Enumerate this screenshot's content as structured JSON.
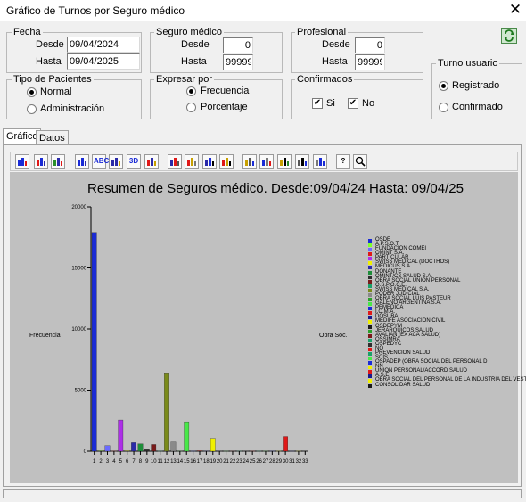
{
  "window": {
    "title": "Gráfico de Turnos por Seguro médico",
    "close_glyph": "✕"
  },
  "fecha": {
    "group_label": "Fecha",
    "desde_label": "Desde",
    "desde_value": "09/04/2024",
    "hasta_label": "Hasta",
    "hasta_value": "09/04/2025"
  },
  "seguro": {
    "group_label": "Seguro médico",
    "desde_label": "Desde",
    "desde_value": "0",
    "hasta_label": "Hasta",
    "hasta_value": "99999"
  },
  "profesional": {
    "group_label": "Profesional",
    "desde_label": "Desde",
    "desde_value": "0",
    "hasta_label": "Hasta",
    "hasta_value": "99999"
  },
  "turno_usuario": {
    "group_label": "Turno usuario",
    "options": [
      {
        "label": "Registrado",
        "selected": true
      },
      {
        "label": "Confirmado",
        "selected": false
      }
    ]
  },
  "tipo_pacientes": {
    "group_label": "Tipo de Pacientes",
    "options": [
      {
        "label": "Normal",
        "selected": true
      },
      {
        "label": "Administración",
        "selected": false
      }
    ]
  },
  "expresar_por": {
    "group_label": "Expresar por",
    "options": [
      {
        "label": "Frecuencia",
        "selected": true
      },
      {
        "label": "Porcentaje",
        "selected": false
      }
    ]
  },
  "confirmados": {
    "group_label": "Confirmados",
    "si_label": "Si",
    "si_checked": true,
    "no_label": "No",
    "no_checked": true
  },
  "tabs": [
    {
      "label": "Gráfico",
      "active": true
    },
    {
      "label": "Datos",
      "active": false
    }
  ],
  "toolbar": {
    "icons": [
      "bar-chart-icon",
      "pie-chart-icon",
      "stacked-bar-icon",
      "data-grid-icon",
      "abc-labels-icon",
      "table-icon",
      "3d-toggle-icon",
      "font-icon",
      "marker-icon",
      "scatter-icon",
      "color-icon",
      "crosshair-icon",
      "highlight-icon",
      "legend-icon",
      "tooltip-icon",
      "copy-icon",
      "edit-pen-icon",
      "help-icon",
      "zoom-icon"
    ],
    "text_glyphs": {
      "abc": "ABC",
      "three_d": "3D",
      "help": "?"
    }
  },
  "colors": {
    "chart_background": "#c0c0c0",
    "accent_green": "#2a8f2a"
  },
  "chart_data": {
    "type": "bar",
    "title": "Resumen de Seguros médico. Desde:09/04/24 Hasta: 09/04/25",
    "ylabel": "Frecuencia",
    "xlabel": "Obra Soc.",
    "ylim": [
      0,
      20000
    ],
    "yticks": [
      0,
      5000,
      10000,
      15000,
      20000
    ],
    "categories": [
      "1",
      "2",
      "3",
      "4",
      "5",
      "6",
      "7",
      "8",
      "9",
      "10",
      "11",
      "12",
      "13",
      "14",
      "15",
      "16",
      "17",
      "18",
      "19",
      "20",
      "21",
      "22",
      "23",
      "24",
      "25",
      "26",
      "27",
      "28",
      "29",
      "30",
      "31",
      "32",
      "33"
    ],
    "values": [
      17900,
      40,
      450,
      20,
      2550,
      40,
      700,
      600,
      130,
      550,
      20,
      6400,
      750,
      20,
      2400,
      20,
      40,
      20,
      1050,
      20,
      20,
      20,
      20,
      20,
      20,
      20,
      20,
      20,
      20,
      1200,
      20,
      20,
      20
    ],
    "colors": [
      "#1a2bd6",
      "#7dff2a",
      "#6b6bff",
      "#e01818",
      "#ad2ee8",
      "#f0f000",
      "#2a2aa8",
      "#1e8e3a",
      "#2e2e2e",
      "#7a1a1a",
      "#1aa06a",
      "#7a8a1a",
      "#8a8a8a",
      "#2aa02a",
      "#48e848",
      "#1a2bd6",
      "#e01818",
      "#1a1a8a",
      "#f0f000",
      "#1a1a1a",
      "#2aa02a",
      "#7a1a1a",
      "#1aa06a",
      "#2e2e2e",
      "#e01818",
      "#1aa06a",
      "#48e848",
      "#1a2bd6",
      "#f0f000",
      "#e01818",
      "#1a1a8a",
      "#f0f000",
      "#1a1a1a"
    ],
    "legend": [
      {
        "label": "OSDE",
        "color": "#1a2bd6"
      },
      {
        "label": "A.P.S.O.T.",
        "color": "#7dff2a"
      },
      {
        "label": "FUNDACION COMEI",
        "color": "#6b6bff"
      },
      {
        "label": "OMINT S.A.",
        "color": "#e01818"
      },
      {
        "label": "PARTICULAR",
        "color": "#ad2ee8"
      },
      {
        "label": "SWISS MEDICAL (DOCTHOS)",
        "color": "#f0f000"
      },
      {
        "label": "MEDICUS S.A.",
        "color": "#2a2aa8"
      },
      {
        "label": "DONANTE",
        "color": "#1e8e3a"
      },
      {
        "label": "OMINT/CS SALUD S.A.",
        "color": "#2e2e2e"
      },
      {
        "label": "OBRA SOCIAL UNION PERSONAL",
        "color": "#7a1a1a"
      },
      {
        "label": "O.S.P.O.C.E.",
        "color": "#1aa06a"
      },
      {
        "label": "SWISS MEDICAL S.A.",
        "color": "#7a8a1a"
      },
      {
        "label": "PODER JUDICIAL",
        "color": "#8a8a8a"
      },
      {
        "label": "OBRA SOCIAL LUIS PASTEUR",
        "color": "#2aa02a"
      },
      {
        "label": "GALENO ARGENTINA S.A.",
        "color": "#48e848"
      },
      {
        "label": "PEMEDICA",
        "color": "#1a2bd6"
      },
      {
        "label": "I.O.M.A.",
        "color": "#e01818"
      },
      {
        "label": "DOSUBA",
        "color": "#1a1a8a"
      },
      {
        "label": "MEDIFE ASOCIACIÓN CIVIL",
        "color": "#f0f000"
      },
      {
        "label": "OSDEPYM",
        "color": "#1a1a1a"
      },
      {
        "label": "JERARQUICOS SALUD",
        "color": "#2aa02a"
      },
      {
        "label": "AVALIAN (EX ACA SALUD)",
        "color": "#7a1a1a"
      },
      {
        "label": "OSSIMRA",
        "color": "#1aa06a"
      },
      {
        "label": "OSPEDYC",
        "color": "#2e2e2e"
      },
      {
        "label": "NO",
        "color": "#e01818"
      },
      {
        "label": "PREVENCION SALUD",
        "color": "#1aa06a"
      },
      {
        "label": "SCIS",
        "color": "#48e848"
      },
      {
        "label": "OSPADEP (OBRA SOCIAL DEL PERSONAL D",
        "color": "#1a2bd6"
      },
      {
        "label": "NN",
        "color": "#f0f000"
      },
      {
        "label": "UNION PERSONAL/ACCORD SALUD",
        "color": "#e01818"
      },
      {
        "label": "A.S.E",
        "color": "#1a1a8a"
      },
      {
        "label": "OBRA SOCIAL DEL PERSONAL DE LA INDUSTRIA DEL VESTIDO",
        "color": "#f0f000"
      },
      {
        "label": "CONSOLIDAR SALUD",
        "color": "#1a1a1a"
      }
    ]
  }
}
